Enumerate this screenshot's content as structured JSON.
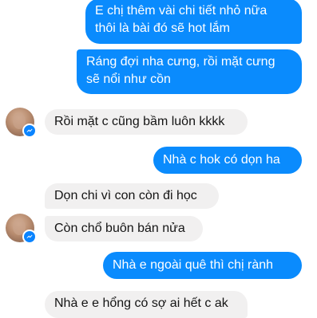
{
  "conversation": {
    "messages": [
      {
        "direction": "outgoing",
        "lines": [
          "E chị thêm vài chi tiết nhỏ nữa",
          "thôi là bài đó sẽ hot lắm"
        ]
      },
      {
        "direction": "outgoing",
        "lines": [
          "Ráng đợi nha cưng, rồi mặt cưng",
          "sẽ nổi như cồn"
        ]
      },
      {
        "direction": "incoming",
        "text": "Rồi mặt c cũng bầm luôn kkkk"
      },
      {
        "direction": "outgoing",
        "text": "Nhà c hok có dọn ha"
      },
      {
        "direction": "incoming",
        "text": "Dọn chi vì con còn đi học"
      },
      {
        "direction": "incoming",
        "text": "Còn chổ buôn bán nửa"
      },
      {
        "direction": "outgoing",
        "text": "Nhà e ngoài quê thì chị rành"
      },
      {
        "direction": "incoming",
        "text": "Nhà e e hổng có sợ ai hết c ak"
      }
    ]
  },
  "colors": {
    "outgoing_bubble": "#0a8bfd",
    "incoming_bubble": "#f1f0f0",
    "messenger_badge": "#0a84ff"
  }
}
